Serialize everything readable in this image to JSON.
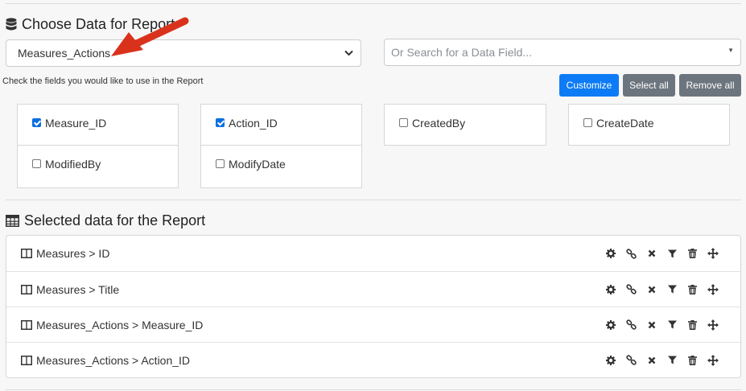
{
  "choose": {
    "title": "Choose Data for Report",
    "table_select_value": "Measures_Actions",
    "search_placeholder": "Or Search for a Data Field...",
    "hint": "Check the fields you would like to use in the Report",
    "buttons": {
      "customize": "Customize",
      "select_all": "Select all",
      "remove_all": "Remove all"
    },
    "fields": [
      {
        "label": "Measure_ID",
        "checked": true
      },
      {
        "label": "Action_ID",
        "checked": true
      },
      {
        "label": "CreatedBy",
        "checked": false
      },
      {
        "label": "CreateDate",
        "checked": false
      },
      {
        "label": "ModifiedBy",
        "checked": false
      },
      {
        "label": "ModifyDate",
        "checked": false
      }
    ]
  },
  "selected": {
    "title": "Selected data for the Report",
    "rows": [
      {
        "label": "Measures > ID"
      },
      {
        "label": "Measures > Title"
      },
      {
        "label": "Measures_Actions > Measure_ID"
      },
      {
        "label": "Measures_Actions > Action_ID"
      }
    ],
    "row_actions": [
      "gear-icon",
      "link-icon",
      "times-icon",
      "filter-icon",
      "trash-icon",
      "move-icon"
    ]
  },
  "colors": {
    "primary": "#0d7bf5",
    "secondary": "#6c757d",
    "checkbox": "#0b6fe0",
    "annotation_arrow": "#d9321c"
  }
}
